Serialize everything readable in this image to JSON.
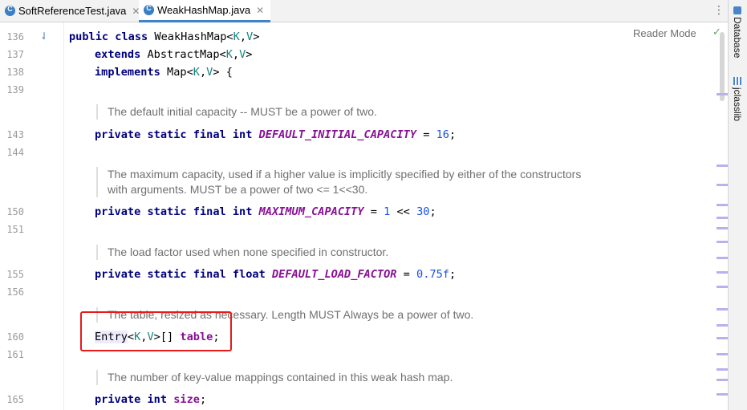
{
  "tabs": [
    {
      "label": "SoftReferenceTest.java",
      "icon": "java-class-icon",
      "active": false
    },
    {
      "label": "WeakHashMap.java",
      "icon": "java-class-icon",
      "active": true
    }
  ],
  "tab_close_glyph": "✕",
  "menu_glyph": "⋮",
  "reader_mode": {
    "label": "Reader Mode",
    "status_glyph": "✓"
  },
  "right_toolbar": [
    {
      "label": "Database",
      "icon": "database-icon"
    },
    {
      "label": "jclasslib",
      "icon": "jclasslib-icon"
    }
  ],
  "colors": {
    "keyword": "#00007f",
    "type_param": "#17847f",
    "constant": "#871094",
    "number": "#1750eb",
    "doc_text": "#707070",
    "highlight_box": "#e81a1a",
    "active_tab_underline": "#4083c9"
  },
  "gutter": {
    "line_numbers": [
      "136",
      "137",
      "138",
      "139",
      "143",
      "144",
      "150",
      "151",
      "155",
      "156",
      "160",
      "161",
      "165"
    ],
    "icon": "implementation-marker-icon",
    "icon_glyph": "⇃"
  },
  "code": {
    "class_decl": {
      "kw1": "public",
      "kw2": "class",
      "name": "WeakHashMap<",
      "tp1": "K",
      ",": ",",
      "tp2": "V",
      ">": ">"
    },
    "extends_line": {
      "kw": "extends",
      "name": "AbstractMap<",
      "tp1": "K",
      "comma": ",",
      "tp2": "V",
      "close": ">"
    },
    "implements_line": {
      "kw": "implements",
      "name": "Map<",
      "tp1": "K",
      "comma": ",",
      "tp2": "V",
      "close": "> {"
    },
    "doc1": "The default initial capacity -- MUST be a power of two.",
    "field1": {
      "mods": "private static final int",
      "name": "DEFAULT_INITIAL_CAPACITY",
      "eq": " = ",
      "value": "16",
      ";": ";"
    },
    "doc2_line1": "The maximum capacity, used if a higher value is implicitly specified by either of the constructors",
    "doc2_line2": "with arguments. MUST be a power of two <= 1<<30.",
    "field2": {
      "mods": "private static final int",
      "name": "MAXIMUM_CAPACITY",
      "eq": " = ",
      "v1": "1",
      "op": " << ",
      "v2": "30",
      "end": ";"
    },
    "doc3": "The load factor used when none specified in constructor.",
    "field3": {
      "mods": "private static final float",
      "name": "DEFAULT_LOAD_FACTOR",
      "eq": " = ",
      "value": "0.75f",
      "end": ";"
    },
    "doc4": "The table, resized as necessary. Length MUST Always be a power of two.",
    "field4": {
      "type": "Entry",
      "lt": "<",
      "tp1": "K",
      "comma": ",",
      "tp2": "V",
      "rest": ">[] ",
      "name": "table",
      "end": ";"
    },
    "doc5": "The number of key-value mappings contained in this weak hash map.",
    "field5": {
      "mods": "private int",
      "name": "size",
      "end": ";"
    }
  }
}
